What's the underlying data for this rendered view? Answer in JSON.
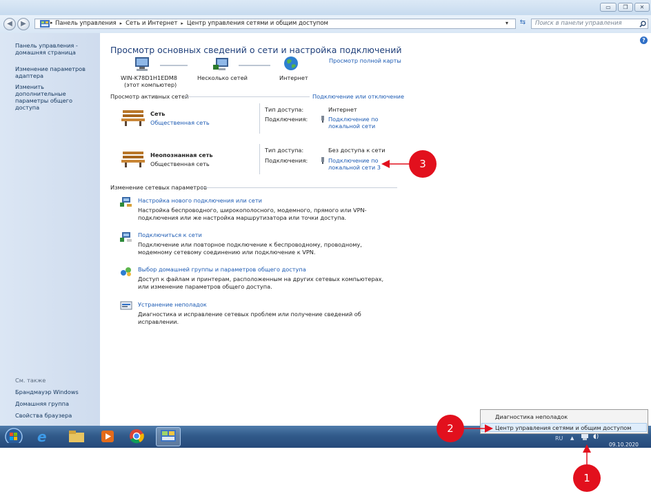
{
  "window": {
    "minimize_icon": "minimize-icon",
    "maximize_icon": "restore-icon",
    "close_icon": "close-icon"
  },
  "address": {
    "crumbs": [
      "Панель управления",
      "Сеть и Интернет",
      "Центр управления сетями и общим доступом"
    ],
    "search_placeholder": "Поиск в панели управления"
  },
  "sidebar": {
    "items": [
      {
        "label": "Панель управления - домашняя страница"
      },
      {
        "label": "Изменение параметров адаптера"
      },
      {
        "label": "Изменить дополнительные параметры общего доступа"
      }
    ],
    "see_also_title": "См. также",
    "see_also": [
      "Брандмауэр Windows",
      "Домашняя группа",
      "Свойства браузера"
    ]
  },
  "main": {
    "title": "Просмотр основных сведений о сети и настройка подключений",
    "full_map": "Просмотр полной карты",
    "computer_name": "WIN-K78D1H1EDM8",
    "computer_sub": "(этот компьютер)",
    "multiple_networks": "Несколько сетей",
    "internet": "Интернет",
    "active_networks": "Просмотр активных сетей",
    "connect_disconnect": "Подключение или отключение",
    "networks": [
      {
        "name": "Сеть",
        "type": "Общественная сеть",
        "type_is_link": true,
        "access_label": "Тип доступа:",
        "access_value": "Интернет",
        "conn_label": "Подключения:",
        "conn_value": "Подключение по локальной сети"
      },
      {
        "name": "Неопознанная сеть",
        "type": "Общественная сеть",
        "type_is_link": false,
        "access_label": "Тип доступа:",
        "access_value": "Без доступа к сети",
        "conn_label": "Подключения:",
        "conn_value": "Подключение по локальной сети 3"
      }
    ],
    "change_settings": "Изменение сетевых параметров",
    "tasks": [
      {
        "title": "Настройка нового подключения или сети",
        "desc": "Настройка беспроводного, широкополосного, модемного, прямого или VPN-подключения или же настройка маршрутизатора или точки доступа."
      },
      {
        "title": "Подключиться к сети",
        "desc": "Подключение или повторное подключение к беспроводному, проводному, модемному сетевому соединению или подключение к VPN."
      },
      {
        "title": "Выбор домашней группы и параметров общего доступа",
        "desc": "Доступ к файлам и принтерам, расположенным на других сетевых компьютерах, или изменение параметров общего доступа."
      },
      {
        "title": "Устранение неполадок",
        "desc": "Диагностика и исправление сетевых проблем или получение сведений об исправлении."
      }
    ]
  },
  "popup": {
    "items": [
      "Диагностика неполадок",
      "Центр управления сетями и общим доступом"
    ]
  },
  "taskbar": {
    "lang": "RU",
    "date": "09.10.2020"
  },
  "annotations": [
    "1",
    "2",
    "3"
  ],
  "colors": {
    "link": "#1b5ab3",
    "title": "#1f3f7a",
    "badge": "#e2101d"
  }
}
